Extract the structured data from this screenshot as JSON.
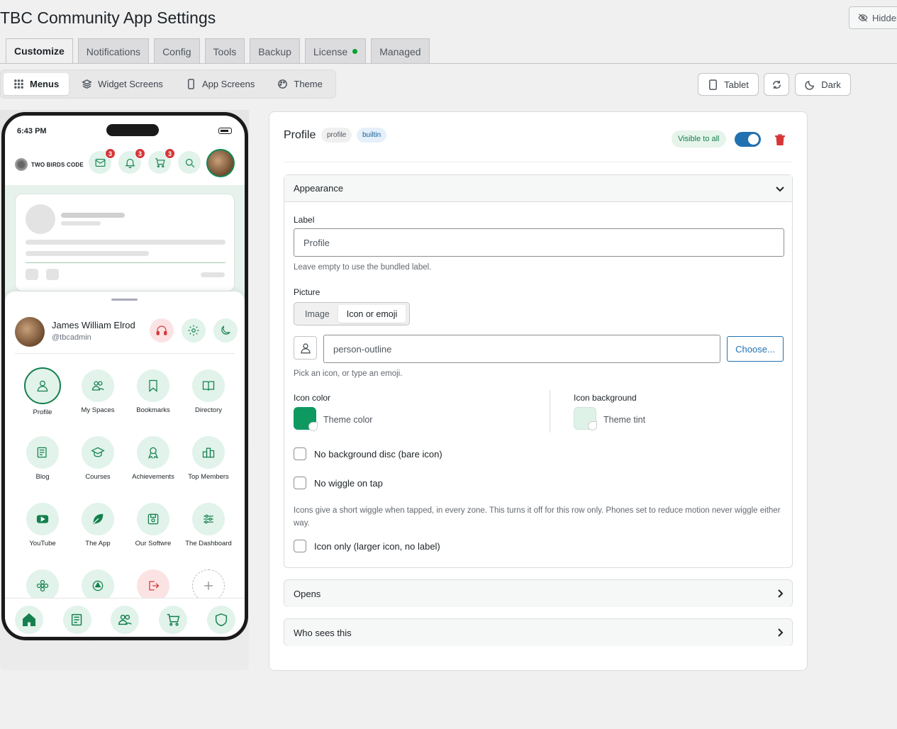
{
  "page": {
    "title": "TBC Community App Settings",
    "hidden_button_label": "Hidden"
  },
  "nav_tabs": [
    {
      "label": "Customize",
      "active": true
    },
    {
      "label": "Notifications"
    },
    {
      "label": "Config"
    },
    {
      "label": "Tools"
    },
    {
      "label": "Backup"
    },
    {
      "label": "License",
      "status_dot": true
    },
    {
      "label": "Managed"
    }
  ],
  "sub_tabs": [
    {
      "label": "Menus",
      "icon": "grid-icon",
      "active": true
    },
    {
      "label": "Widget Screens",
      "icon": "layers-icon"
    },
    {
      "label": "App Screens",
      "icon": "phone-icon"
    },
    {
      "label": "Theme",
      "icon": "palette-icon"
    }
  ],
  "toolbar": {
    "tablet_label": "Tablet",
    "dark_label": "Dark"
  },
  "phone": {
    "time": "6:43 PM",
    "brand": "TWO BIRDS CODE",
    "badges": {
      "mail": "3",
      "bell": "3",
      "cart": "3"
    },
    "user": {
      "name": "James William Elrod",
      "handle": "@tbcadmin"
    },
    "grid": [
      {
        "label": "Profile",
        "icon": "person-icon",
        "selected": true
      },
      {
        "label": "My Spaces",
        "icon": "people-icon"
      },
      {
        "label": "Bookmarks",
        "icon": "bookmark-icon"
      },
      {
        "label": "Directory",
        "icon": "book-icon"
      },
      {
        "label": "Blog",
        "icon": "newspaper-icon"
      },
      {
        "label": "Courses",
        "icon": "school-icon"
      },
      {
        "label": "Achievements",
        "icon": "ribbon-icon"
      },
      {
        "label": "Top Members",
        "icon": "podium-icon"
      },
      {
        "label": "YouTube",
        "icon": "youtube-icon"
      },
      {
        "label": "The App",
        "icon": "leaf-icon"
      },
      {
        "label": "Our Softwre",
        "icon": "save-icon"
      },
      {
        "label": "The Dashboard",
        "icon": "sliders-icon"
      }
    ]
  },
  "panel": {
    "title": "Profile",
    "tag_slug": "profile",
    "tag_type": "builtin",
    "visibility_label": "Visible to all",
    "appearance": {
      "header": "Appearance",
      "label_field": {
        "label": "Label",
        "placeholder": "Profile",
        "help": "Leave empty to use the bundled label."
      },
      "picture": {
        "label": "Picture",
        "options": [
          "Image",
          "Icon or emoji"
        ],
        "selected": "Icon or emoji",
        "icon_value": "person-outline",
        "choose_label": "Choose...",
        "help": "Pick an icon, or type an emoji."
      },
      "icon_color": {
        "label": "Icon color",
        "value_label": "Theme color",
        "color": "#0e9960"
      },
      "icon_background": {
        "label": "Icon background",
        "value_label": "Theme tint",
        "color": "#dff2e7"
      },
      "checkboxes": {
        "no_background": "No background disc (bare icon)",
        "no_wiggle": "No wiggle on tap",
        "wiggle_help": "Icons give a short wiggle when tapped, in every zone. This turns it off for this row only. Phones set to reduce motion never wiggle either way.",
        "icon_only": "Icon only (larger icon, no label)"
      }
    },
    "opens_header": "Opens",
    "who_sees_header": "Who sees this"
  },
  "colors": {
    "accent": "#13804d",
    "wp_blue": "#2271b1",
    "danger": "#d63638"
  }
}
